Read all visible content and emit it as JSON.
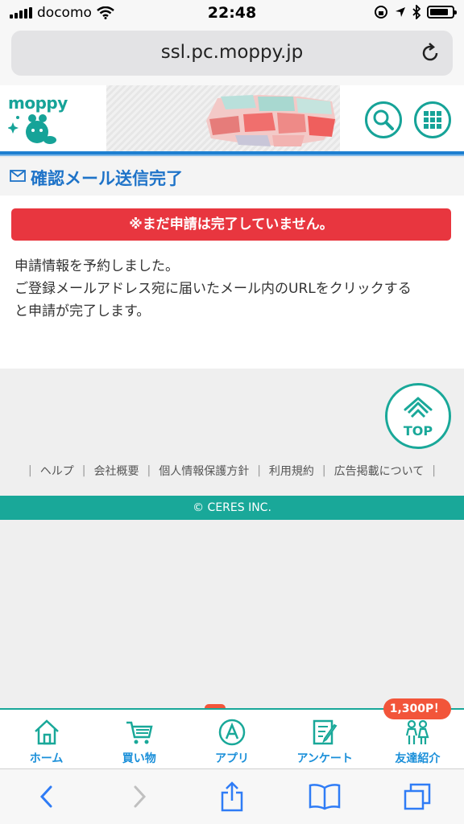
{
  "status": {
    "carrier": "docomo",
    "time": "22:48"
  },
  "browser": {
    "url": "ssl.pc.moppy.jp"
  },
  "header": {
    "logo_text": "moppy"
  },
  "section": {
    "title": "確認メール送信完了"
  },
  "alert": {
    "text": "※まだ申請は完了していません。"
  },
  "message": {
    "line1": "申請情報を予約しました。",
    "line2": "ご登録メールアドレス宛に届いたメール内のURLをクリックする",
    "line3": "と申請が完了します。"
  },
  "top_button": {
    "label": "TOP"
  },
  "footer": {
    "links": [
      "ヘルプ",
      "会社概要",
      "個人情報保護方針",
      "利用規約",
      "広告掲載について"
    ],
    "copyright": "© CERES INC."
  },
  "app_nav": {
    "reward_badge": "1,300P！",
    "items": [
      {
        "label": "ホーム",
        "icon": "home-icon"
      },
      {
        "label": "買い物",
        "icon": "cart-icon"
      },
      {
        "label": "アプリ",
        "icon": "app-icon"
      },
      {
        "label": "アンケート",
        "icon": "survey-icon"
      },
      {
        "label": "友達紹介",
        "icon": "friends-icon"
      }
    ]
  },
  "colors": {
    "accent": "#19a899",
    "alert": "#e8363f",
    "link_blue": "#1a8fd9",
    "title_blue": "#1e73c8"
  }
}
